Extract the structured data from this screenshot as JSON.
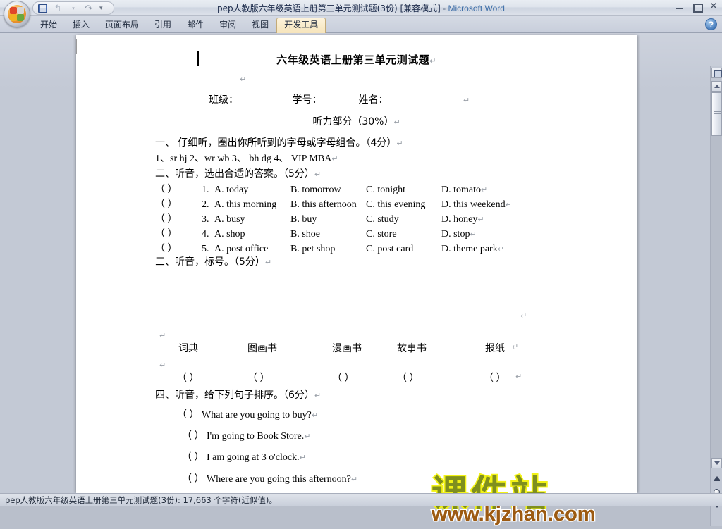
{
  "window": {
    "title_doc": "pep人教版六年级英语上册第三单元测试题(3份) [兼容模式]",
    "title_dash": " - ",
    "title_app": "Microsoft Word",
    "minimize_label": "",
    "maximize_label": "",
    "close_label": "✕",
    "help_label": "?"
  },
  "quick_access": {
    "save_label": "",
    "undo_label": "↰",
    "redo_label": "↷",
    "more_label": "▾"
  },
  "ribbon": {
    "tabs": [
      {
        "label": "开始",
        "active": false
      },
      {
        "label": "插入",
        "active": false
      },
      {
        "label": "页面布局",
        "active": false
      },
      {
        "label": "引用",
        "active": false
      },
      {
        "label": "邮件",
        "active": false
      },
      {
        "label": "审阅",
        "active": false
      },
      {
        "label": "视图",
        "active": false
      },
      {
        "label": "开发工具",
        "active": true
      }
    ]
  },
  "document": {
    "title": "六年级英语上册第三单元测试题",
    "pilcrow": "↵",
    "name_row": {
      "class_label": "班级：",
      "id_label": "学号：",
      "name_label": "姓名："
    },
    "subhead": "听力部分（30%）",
    "section1": {
      "heading": "一、    仔细听，圈出你所听到的字母或字母组合。（4分）",
      "items": "1、sr   hj        2、wr    wb        3、   bh    dg        4、  VIP   MBA"
    },
    "section2": {
      "heading": "二、听音，选出合适的答案。（5分）",
      "questions": [
        {
          "paren": "（    ）",
          "num": "1.",
          "a": "A. today",
          "b": "B. tomorrow",
          "c": "C. tonight",
          "d": "D. tomato"
        },
        {
          "paren": "（    ）",
          "num": "2.",
          "a": "A. this morning",
          "b": "B. this afternoon",
          "c": "C. this evening",
          "d": "D. this weekend"
        },
        {
          "paren": "（    ）",
          "num": "3.",
          "a": "A. busy",
          "b": "B. buy",
          "c": "C. study",
          "d": "D. honey"
        },
        {
          "paren": "（    ）",
          "num": "4.",
          "a": "A. shop",
          "b": "B. shoe",
          "c": "C. store",
          "d": "D. stop"
        },
        {
          "paren": "（    ）",
          "num": "5.",
          "a": "A. post office",
          "b": "B. pet shop",
          "c": "C. post card",
          "d": "D. theme park"
        }
      ]
    },
    "section3": {
      "heading": "三、听音，标号。（5分）",
      "words": [
        "词典",
        "图画书",
        "漫画书",
        "故事书",
        "报纸"
      ],
      "answer_paren": "（    ）"
    },
    "section4": {
      "heading": "四、听音，给下列句子排序。（6分）",
      "sentences": [
        {
          "paren": "（   ）",
          "text": "What are you going to buy?"
        },
        {
          "paren": "（   ）",
          "text": "I'm going to Book Store."
        },
        {
          "paren": "（   ）",
          "text": "I am going at 3 o'clock."
        },
        {
          "paren": "（   ）",
          "text": "Where are you going this afternoon?"
        }
      ]
    }
  },
  "watermark": {
    "cn_text": "课件站",
    "url_text": "www.kjzhan.com",
    "cn_color": "#7f8f1e",
    "cn_outline": "#f2f216",
    "url_color": "#9c5a12"
  },
  "statusbar": {
    "text": "pep人教版六年级英语上册第三单元测试题(3份): 17,663 个字符(近似值)。"
  },
  "scrollbar": {
    "ruler_toggle": "view-ruler",
    "up_label": "▲",
    "down_label": "▼",
    "prev_page_label": "▲",
    "browse_object_label": "◉",
    "next_page_label": "▼"
  }
}
